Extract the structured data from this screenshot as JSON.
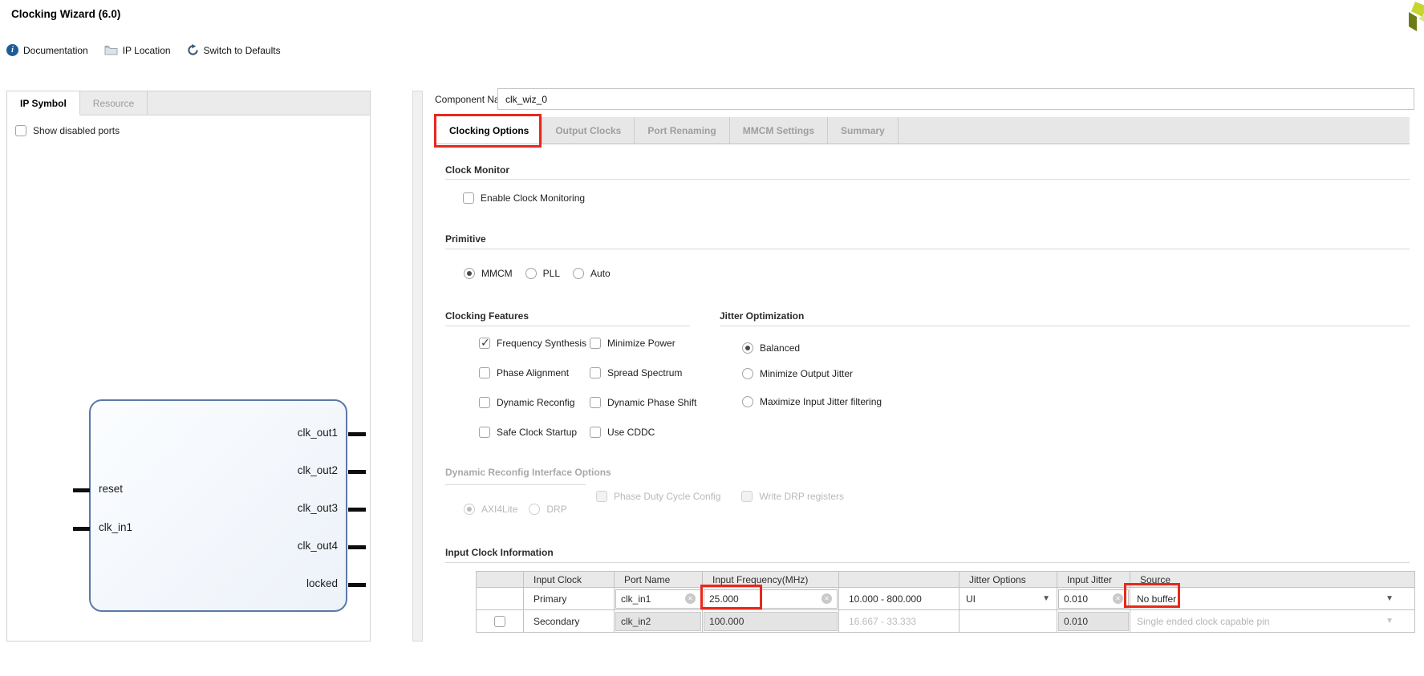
{
  "window": {
    "title": "Clocking Wizard (6.0)"
  },
  "toolbar": {
    "items": [
      {
        "label": "Documentation",
        "icon": "info-icon"
      },
      {
        "label": "IP Location",
        "icon": "folder-icon"
      },
      {
        "label": "Switch to Defaults",
        "icon": "refresh-icon"
      }
    ]
  },
  "left_panel": {
    "tabs": [
      {
        "label": "IP Symbol",
        "active": true
      },
      {
        "label": "Resource",
        "active": false
      }
    ],
    "show_disabled_ports_label": "Show disabled ports",
    "show_disabled_ports_checked": false,
    "ip_symbol": {
      "input_ports": [
        "reset",
        "clk_in1"
      ],
      "output_ports": [
        "clk_out1",
        "clk_out2",
        "clk_out3",
        "clk_out4",
        "locked"
      ]
    }
  },
  "component_name": {
    "label": "Component Name",
    "value": "clk_wiz_0"
  },
  "tabs": [
    {
      "label": "Clocking Options",
      "active": true,
      "highlighted": true
    },
    {
      "label": "Output Clocks",
      "active": false
    },
    {
      "label": "Port Renaming",
      "active": false
    },
    {
      "label": "MMCM Settings",
      "active": false
    },
    {
      "label": "Summary",
      "active": false
    }
  ],
  "clock_monitor": {
    "title": "Clock Monitor",
    "enable_label": "Enable Clock Monitoring",
    "enable_checked": false
  },
  "primitive": {
    "title": "Primitive",
    "options": [
      {
        "label": "MMCM",
        "selected": true
      },
      {
        "label": "PLL",
        "selected": false
      },
      {
        "label": "Auto",
        "selected": false
      }
    ]
  },
  "clocking_features": {
    "title": "Clocking Features",
    "options": [
      {
        "label": "Frequency Synthesis",
        "checked": true
      },
      {
        "label": "Minimize Power",
        "checked": false
      },
      {
        "label": "Phase Alignment",
        "checked": false
      },
      {
        "label": "Spread Spectrum",
        "checked": false
      },
      {
        "label": "Dynamic Reconfig",
        "checked": false
      },
      {
        "label": "Dynamic Phase Shift",
        "checked": false
      },
      {
        "label": "Safe Clock Startup",
        "checked": false
      },
      {
        "label": "Use CDDC",
        "checked": false
      }
    ]
  },
  "jitter_optimization": {
    "title": "Jitter Optimization",
    "options": [
      {
        "label": "Balanced",
        "selected": true
      },
      {
        "label": "Minimize Output Jitter",
        "selected": false
      },
      {
        "label": "Maximize Input Jitter filtering",
        "selected": false
      }
    ]
  },
  "dynamic_reconfig": {
    "title": "Dynamic Reconfig Interface Options",
    "disabled": true,
    "interface_options": [
      {
        "label": "AXI4Lite",
        "selected": true
      },
      {
        "label": "DRP",
        "selected": false
      }
    ],
    "checkbox_options": [
      {
        "label": "Phase Duty Cycle Config",
        "checked": false
      },
      {
        "label": "Write DRP registers",
        "checked": false
      }
    ]
  },
  "input_clock_info": {
    "title": "Input Clock Information",
    "columns": [
      "",
      "Input Clock",
      "Port Name",
      "Input Frequency(MHz)",
      "",
      "Jitter Options",
      "Input Jitter",
      "Source"
    ],
    "primary": {
      "name": "Primary",
      "port_name": "clk_in1",
      "input_frequency": "25.000",
      "freq_range": "10.000 - 800.000",
      "jitter_options": "UI",
      "input_jitter": "0.010",
      "source": "No buffer"
    },
    "secondary": {
      "name": "Secondary",
      "enabled": false,
      "port_name": "clk_in2",
      "input_frequency": "100.000",
      "freq_range": "16.667 - 33.333",
      "jitter_options": "",
      "input_jitter": "0.010",
      "source": "Single ended clock capable pin"
    }
  },
  "highlights": {
    "color": "#e8281c",
    "targets": [
      "clocking-options-tab",
      "primary-input-frequency",
      "primary-source"
    ]
  }
}
